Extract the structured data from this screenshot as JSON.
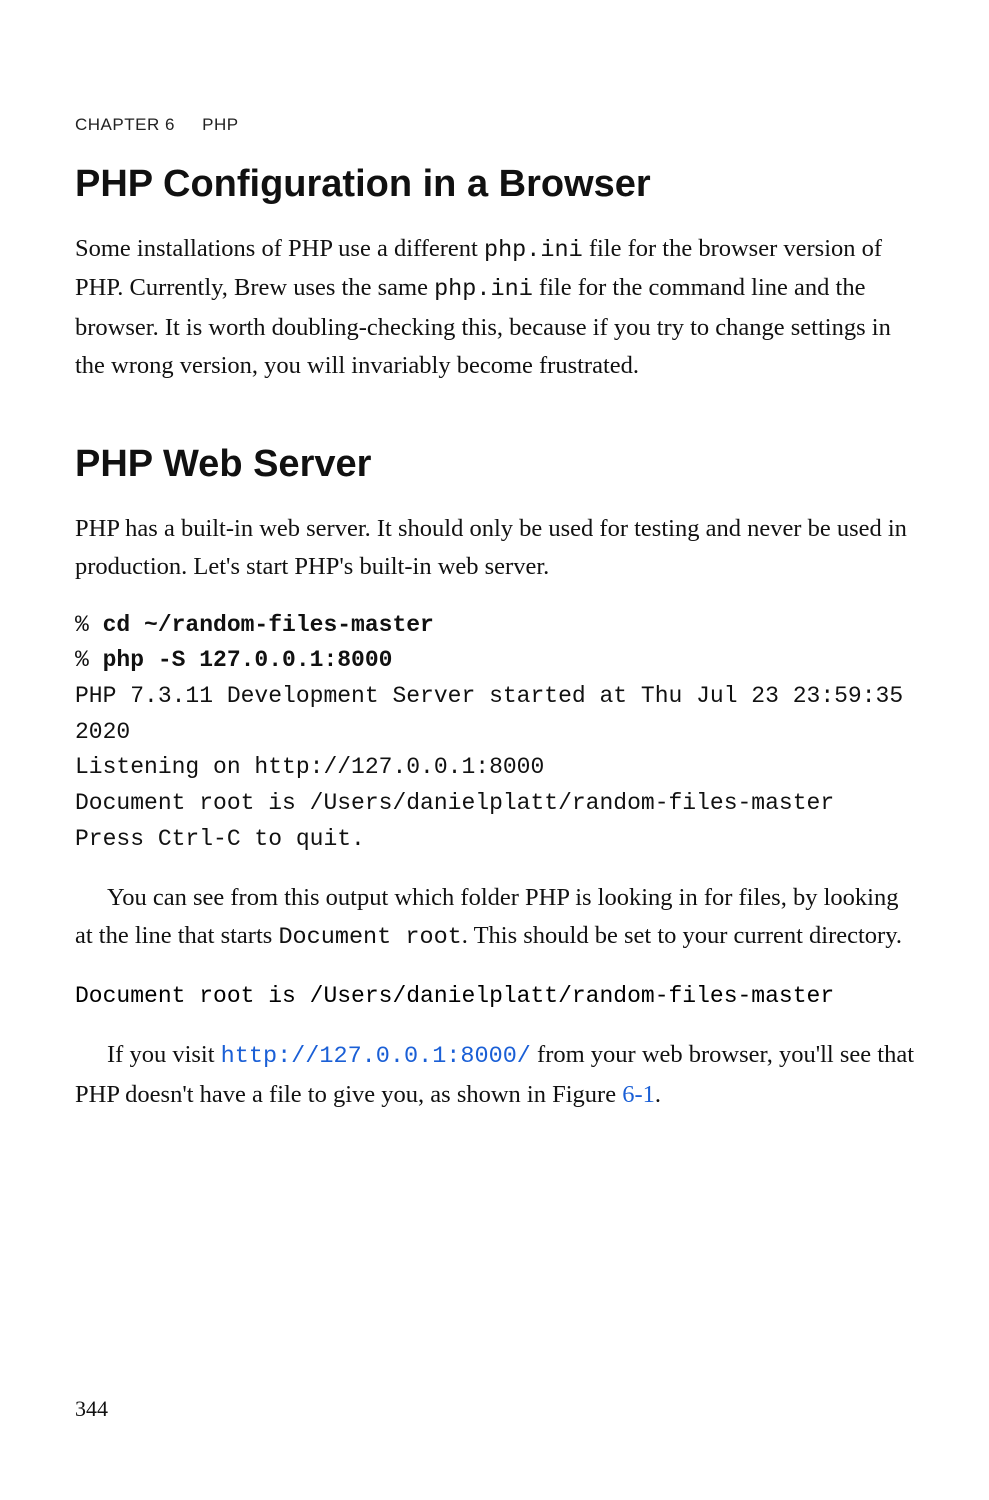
{
  "running_head": {
    "chapter": "CHAPTER 6",
    "title": "PHP"
  },
  "section1": {
    "heading": "PHP Configuration in a Browser",
    "para_parts": {
      "a": "Some installations of PHP use a different ",
      "code1": "php.ini",
      "b": " file for the browser version of PHP. Currently, Brew uses the same ",
      "code2": "php.ini",
      "c": " file for the command line and the browser. It is worth doubling-checking this, because if you try to change settings in the wrong version, you will invariably become frustrated."
    }
  },
  "section2": {
    "heading": "PHP Web Server",
    "intro": "PHP has a built-in web server. It should only be used for testing and never be used in production. Let's start PHP's built-in web server.",
    "codeblock": {
      "p1_prompt": "% ",
      "p1_cmd": "cd ~/random-files-master",
      "p2_prompt": "% ",
      "p2_cmd": "php -S 127.0.0.1:8000",
      "out1": "PHP 7.3.11 Development Server started at Thu Jul 23 23:59:35 2020",
      "out2": "Listening on http://127.0.0.1:8000",
      "out3": "Document root is /Users/danielplatt/random-files-master",
      "out4": "Press Ctrl-C to quit."
    },
    "para2": {
      "a": "You can see from this output which folder PHP is looking in for files, by looking at the line that starts ",
      "code1": "Document root",
      "b": ". This should be set to your current directory."
    },
    "codeline": "Document root is /Users/danielplatt/random-files-master",
    "para3": {
      "a": "If you visit ",
      "link_text": "http://127.0.0.1:8000/",
      "b": " from your web browser, you'll see that PHP doesn't have a file to give you, as shown in Figure ",
      "figref": "6-1",
      "c": "."
    }
  },
  "page_number": "344"
}
